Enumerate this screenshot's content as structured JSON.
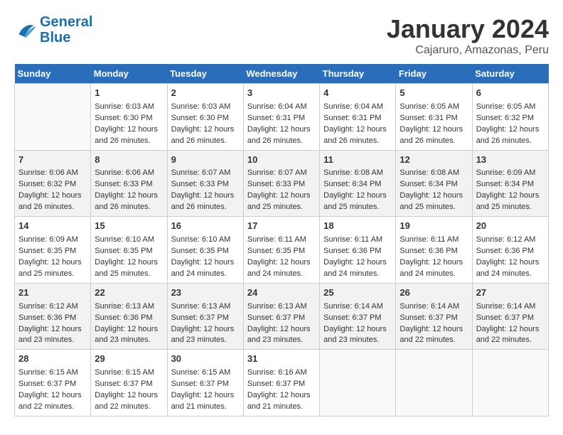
{
  "header": {
    "logo_line1": "General",
    "logo_line2": "Blue",
    "month": "January 2024",
    "location": "Cajaruro, Amazonas, Peru"
  },
  "weekdays": [
    "Sunday",
    "Monday",
    "Tuesday",
    "Wednesday",
    "Thursday",
    "Friday",
    "Saturday"
  ],
  "weeks": [
    [
      {
        "day": "",
        "info": ""
      },
      {
        "day": "1",
        "info": "Sunrise: 6:03 AM\nSunset: 6:30 PM\nDaylight: 12 hours\nand 26 minutes."
      },
      {
        "day": "2",
        "info": "Sunrise: 6:03 AM\nSunset: 6:30 PM\nDaylight: 12 hours\nand 26 minutes."
      },
      {
        "day": "3",
        "info": "Sunrise: 6:04 AM\nSunset: 6:31 PM\nDaylight: 12 hours\nand 26 minutes."
      },
      {
        "day": "4",
        "info": "Sunrise: 6:04 AM\nSunset: 6:31 PM\nDaylight: 12 hours\nand 26 minutes."
      },
      {
        "day": "5",
        "info": "Sunrise: 6:05 AM\nSunset: 6:31 PM\nDaylight: 12 hours\nand 26 minutes."
      },
      {
        "day": "6",
        "info": "Sunrise: 6:05 AM\nSunset: 6:32 PM\nDaylight: 12 hours\nand 26 minutes."
      }
    ],
    [
      {
        "day": "7",
        "info": "Sunrise: 6:06 AM\nSunset: 6:32 PM\nDaylight: 12 hours\nand 26 minutes."
      },
      {
        "day": "8",
        "info": "Sunrise: 6:06 AM\nSunset: 6:33 PM\nDaylight: 12 hours\nand 26 minutes."
      },
      {
        "day": "9",
        "info": "Sunrise: 6:07 AM\nSunset: 6:33 PM\nDaylight: 12 hours\nand 26 minutes."
      },
      {
        "day": "10",
        "info": "Sunrise: 6:07 AM\nSunset: 6:33 PM\nDaylight: 12 hours\nand 25 minutes."
      },
      {
        "day": "11",
        "info": "Sunrise: 6:08 AM\nSunset: 6:34 PM\nDaylight: 12 hours\nand 25 minutes."
      },
      {
        "day": "12",
        "info": "Sunrise: 6:08 AM\nSunset: 6:34 PM\nDaylight: 12 hours\nand 25 minutes."
      },
      {
        "day": "13",
        "info": "Sunrise: 6:09 AM\nSunset: 6:34 PM\nDaylight: 12 hours\nand 25 minutes."
      }
    ],
    [
      {
        "day": "14",
        "info": "Sunrise: 6:09 AM\nSunset: 6:35 PM\nDaylight: 12 hours\nand 25 minutes."
      },
      {
        "day": "15",
        "info": "Sunrise: 6:10 AM\nSunset: 6:35 PM\nDaylight: 12 hours\nand 25 minutes."
      },
      {
        "day": "16",
        "info": "Sunrise: 6:10 AM\nSunset: 6:35 PM\nDaylight: 12 hours\nand 24 minutes."
      },
      {
        "day": "17",
        "info": "Sunrise: 6:11 AM\nSunset: 6:35 PM\nDaylight: 12 hours\nand 24 minutes."
      },
      {
        "day": "18",
        "info": "Sunrise: 6:11 AM\nSunset: 6:36 PM\nDaylight: 12 hours\nand 24 minutes."
      },
      {
        "day": "19",
        "info": "Sunrise: 6:11 AM\nSunset: 6:36 PM\nDaylight: 12 hours\nand 24 minutes."
      },
      {
        "day": "20",
        "info": "Sunrise: 6:12 AM\nSunset: 6:36 PM\nDaylight: 12 hours\nand 24 minutes."
      }
    ],
    [
      {
        "day": "21",
        "info": "Sunrise: 6:12 AM\nSunset: 6:36 PM\nDaylight: 12 hours\nand 23 minutes."
      },
      {
        "day": "22",
        "info": "Sunrise: 6:13 AM\nSunset: 6:36 PM\nDaylight: 12 hours\nand 23 minutes."
      },
      {
        "day": "23",
        "info": "Sunrise: 6:13 AM\nSunset: 6:37 PM\nDaylight: 12 hours\nand 23 minutes."
      },
      {
        "day": "24",
        "info": "Sunrise: 6:13 AM\nSunset: 6:37 PM\nDaylight: 12 hours\nand 23 minutes."
      },
      {
        "day": "25",
        "info": "Sunrise: 6:14 AM\nSunset: 6:37 PM\nDaylight: 12 hours\nand 23 minutes."
      },
      {
        "day": "26",
        "info": "Sunrise: 6:14 AM\nSunset: 6:37 PM\nDaylight: 12 hours\nand 22 minutes."
      },
      {
        "day": "27",
        "info": "Sunrise: 6:14 AM\nSunset: 6:37 PM\nDaylight: 12 hours\nand 22 minutes."
      }
    ],
    [
      {
        "day": "28",
        "info": "Sunrise: 6:15 AM\nSunset: 6:37 PM\nDaylight: 12 hours\nand 22 minutes."
      },
      {
        "day": "29",
        "info": "Sunrise: 6:15 AM\nSunset: 6:37 PM\nDaylight: 12 hours\nand 22 minutes."
      },
      {
        "day": "30",
        "info": "Sunrise: 6:15 AM\nSunset: 6:37 PM\nDaylight: 12 hours\nand 21 minutes."
      },
      {
        "day": "31",
        "info": "Sunrise: 6:16 AM\nSunset: 6:37 PM\nDaylight: 12 hours\nand 21 minutes."
      },
      {
        "day": "",
        "info": ""
      },
      {
        "day": "",
        "info": ""
      },
      {
        "day": "",
        "info": ""
      }
    ]
  ]
}
